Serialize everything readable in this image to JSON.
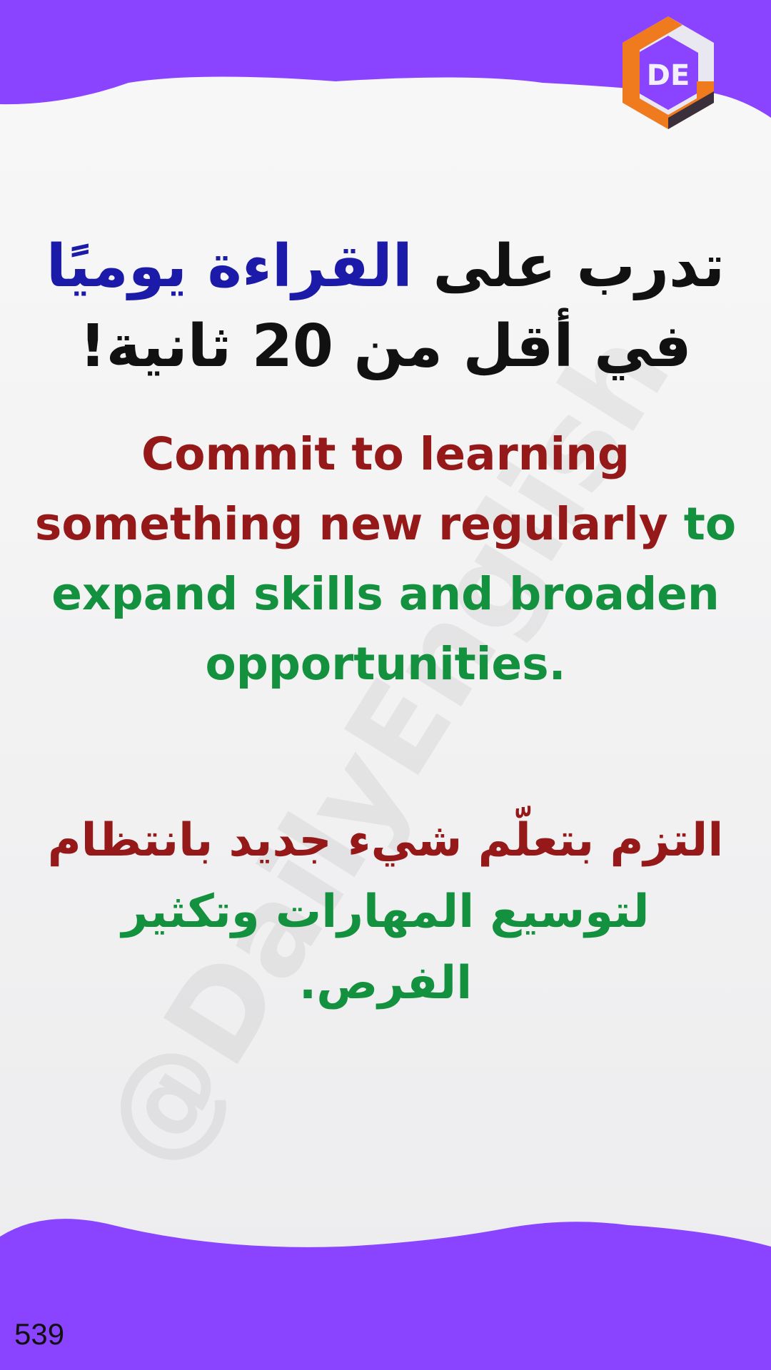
{
  "theme": {
    "wave_color": "#8a43ff",
    "highlight_color": "#1c1aa8",
    "red_text_color": "#951919",
    "green_text_color": "#14913f"
  },
  "logo": {
    "text": "DE",
    "icon": "hexagon-logo-icon"
  },
  "watermark": {
    "text": "@DailyEnglish"
  },
  "title_ar": {
    "part1": "تدرب على ",
    "highlight": "القراءة يوميًا",
    "part2": " في أقل من 20 ثانية!"
  },
  "english": {
    "red_part": "Commit to learning something new regularly",
    "green_part": " to expand skills and broaden opportunities."
  },
  "arabic": {
    "line1": "التزم بتعلّم شيء جديد بانتظام",
    "line2": "لتوسيع المهارات وتكثير الفرص."
  },
  "page_number": "539"
}
